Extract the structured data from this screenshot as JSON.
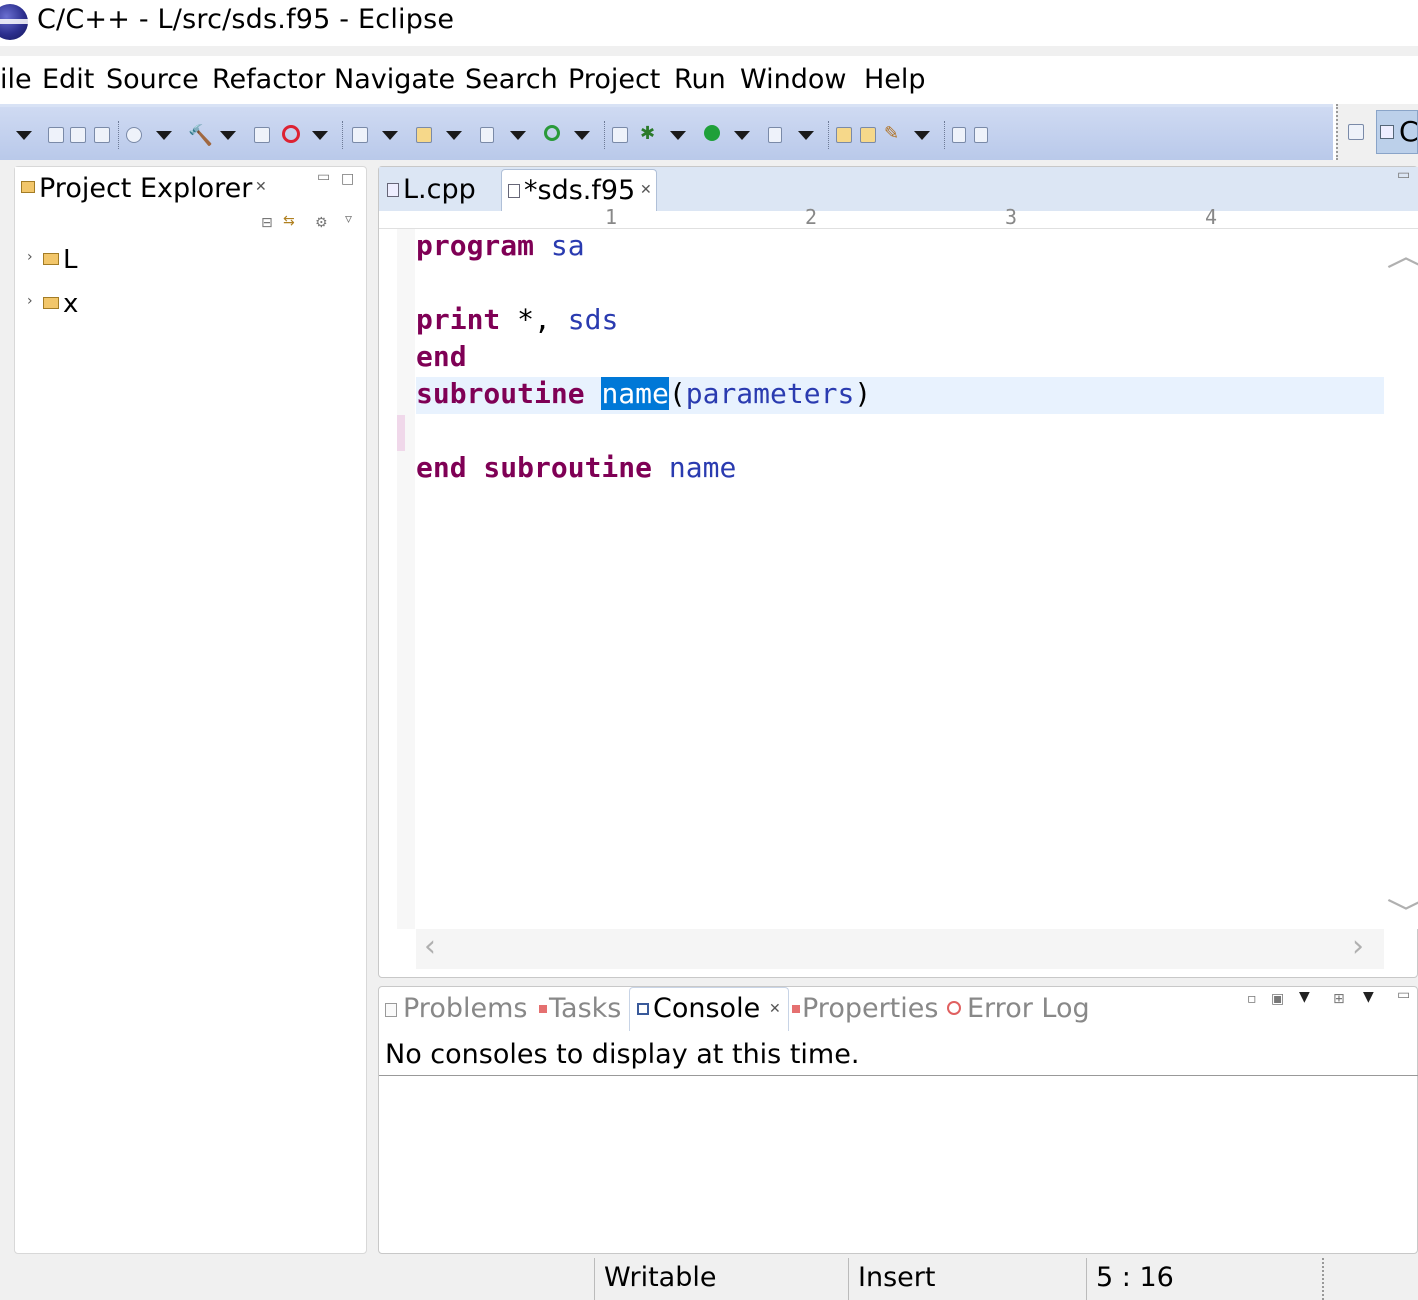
{
  "window": {
    "title": "C/C++ - L/src/sds.f95 - Eclipse"
  },
  "menu": [
    "ile",
    "Edit",
    "Source",
    "Refactor",
    "Navigate",
    "Search",
    "Project",
    "Run",
    "Window",
    "Help"
  ],
  "perspective": {
    "label": "C"
  },
  "explorer": {
    "title": "Project Explorer",
    "items": [
      {
        "label": "L"
      },
      {
        "label": "x"
      }
    ]
  },
  "editor": {
    "tabs": [
      {
        "label": "L.cpp"
      },
      {
        "label": "*sds.f95"
      }
    ],
    "ruler": [
      "1",
      "2",
      "3",
      "4"
    ],
    "code": {
      "line1": {
        "kw": "program",
        "id": "sa"
      },
      "line3": {
        "kw": "print",
        "rest": " *, ",
        "id": "sds"
      },
      "line4": {
        "kw": "end"
      },
      "line5": {
        "kw": "subroutine",
        "sel": "name",
        "open": "(",
        "param": "parameters",
        "close": ")"
      },
      "line7": {
        "kw": "end subroutine",
        "id": "name"
      }
    }
  },
  "bottom_panel": {
    "tabs": [
      "Problems",
      "Tasks",
      "Console",
      "Properties",
      "Error Log"
    ],
    "active_tab": "Console",
    "message": "No consoles to display at this time."
  },
  "status": {
    "writable": "Writable",
    "mode": "Insert",
    "position": "5 : 16"
  },
  "colors": {
    "keyword": "#7f0055",
    "identifier": "#2a3bb0",
    "selection": "#0078d7",
    "toolbar": "#c3d1ee"
  }
}
